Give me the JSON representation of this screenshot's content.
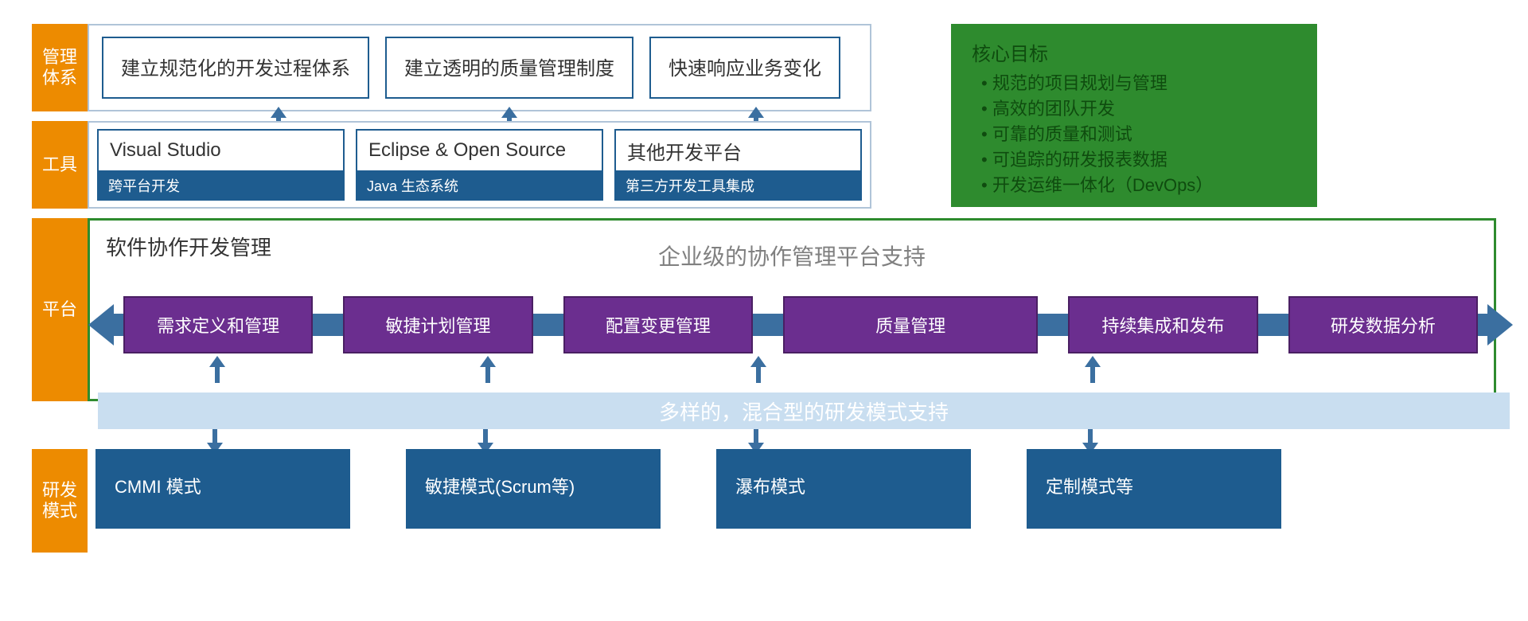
{
  "sidebar": {
    "row1": "管理\n体系",
    "row2": "工具",
    "row3": "平台",
    "row4": "研发\n模式"
  },
  "management": {
    "boxes": [
      "建立规范化的开发过程体系",
      "建立透明的质量管理制度",
      "快速响应业务变化"
    ]
  },
  "goals": {
    "title": "核心目标",
    "items": [
      "规范的项目规划与管理",
      "高效的团队开发",
      "可靠的质量和测试",
      "可追踪的研发报表数据",
      "开发运维一体化（DevOps）"
    ]
  },
  "tools": [
    {
      "head": "Visual Studio",
      "sub": "跨平台开发"
    },
    {
      "head": "Eclipse & Open Source",
      "sub": "Java 生态系统"
    },
    {
      "head": "其他开发平台",
      "sub": "第三方开发工具集成"
    }
  ],
  "platform": {
    "title": "软件协作开发管理",
    "subtitle": "企业级的协作管理平台支持",
    "flow": [
      "需求定义和管理",
      "敏捷计划管理",
      "配置变更管理",
      "质量管理",
      "持续集成和发布",
      "研发数据分析"
    ],
    "mixed_bar": "多样的，混合型的研发模式支持"
  },
  "modes": [
    "CMMI 模式",
    "敏捷模式(Scrum等)",
    "瀑布模式",
    "定制模式等"
  ]
}
